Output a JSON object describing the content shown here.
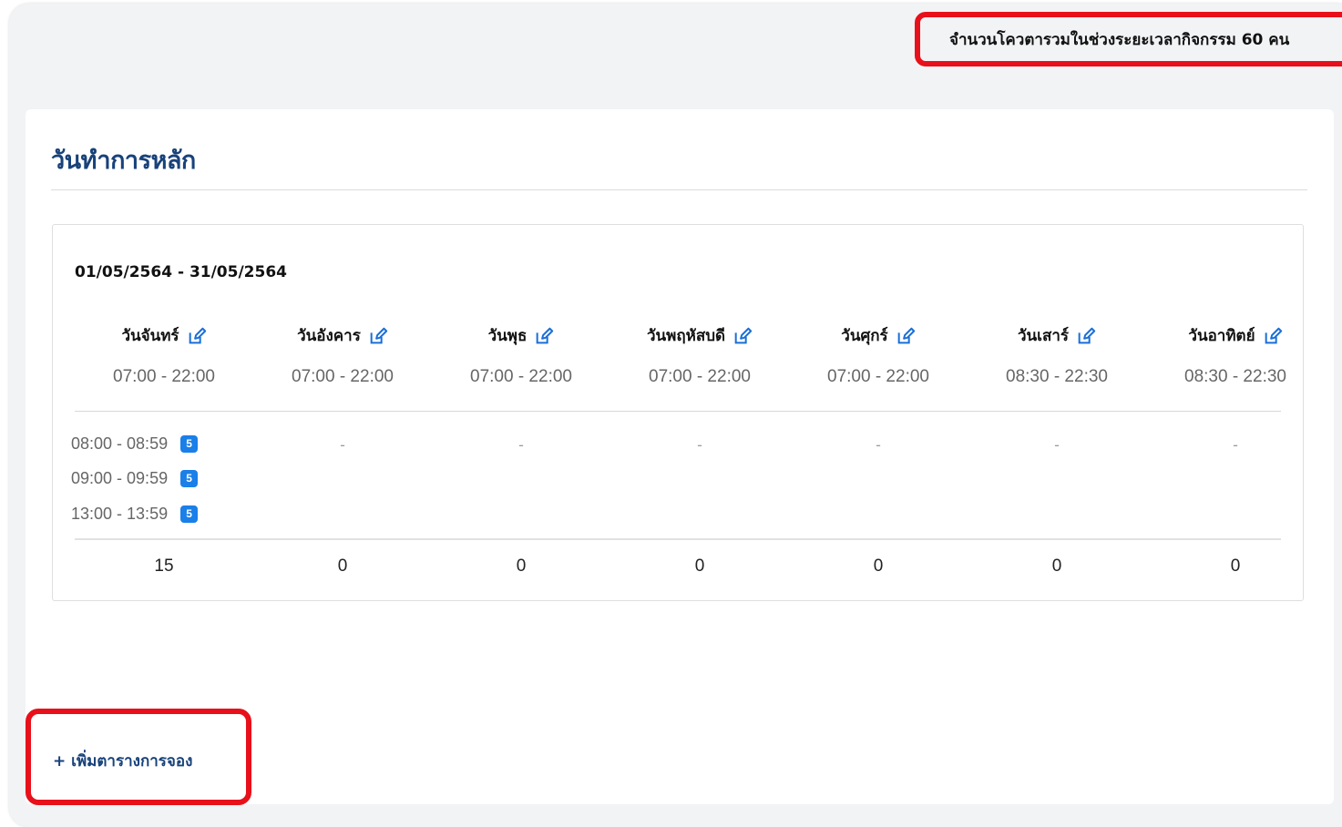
{
  "header": {
    "quota_text": "จำนวนโควตารวมในช่วงระยะเวลากิจกรรม 60 คน"
  },
  "card": {
    "title": "วันทำการหลัก"
  },
  "schedule": {
    "date_range": "01/05/2564 - 31/05/2564",
    "days": [
      {
        "name": "วันจันทร์",
        "hours": "07:00 - 22:00",
        "total": "15"
      },
      {
        "name": "วันอังคาร",
        "hours": "07:00 - 22:00",
        "total": "0",
        "empty": "-"
      },
      {
        "name": "วันพุธ",
        "hours": "07:00 - 22:00",
        "total": "0",
        "empty": "-"
      },
      {
        "name": "วันพฤหัสบดี",
        "hours": "07:00 - 22:00",
        "total": "0",
        "empty": "-"
      },
      {
        "name": "วันศุกร์",
        "hours": "07:00 - 22:00",
        "total": "0",
        "empty": "-"
      },
      {
        "name": "วันเสาร์",
        "hours": "08:30 - 22:30",
        "total": "0",
        "empty": "-"
      },
      {
        "name": "วันอาทิตย์",
        "hours": "08:30 - 22:30",
        "total": "0",
        "empty": "-"
      }
    ],
    "monday_slots": [
      {
        "time": "08:00 - 08:59",
        "count": "5"
      },
      {
        "time": "09:00 - 09:59",
        "count": "5"
      },
      {
        "time": "13:00 - 13:59",
        "count": "5"
      }
    ],
    "edit_icon": "edit-icon"
  },
  "actions": {
    "add_schedule_label": "+ เพิ่มตารางการจอง"
  },
  "colors": {
    "accent": "#18427a",
    "highlight": "#e8101a",
    "badge": "#1a7fe8"
  }
}
